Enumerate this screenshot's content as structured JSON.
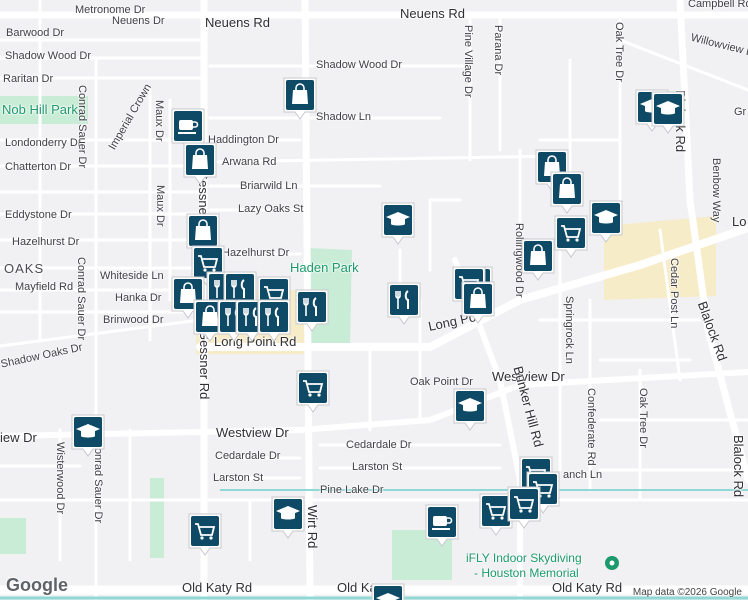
{
  "map": {
    "colors": {
      "background": "#f1f0f3",
      "road": "#ffffff",
      "road_edge": "#d7d6dc",
      "park": "#c9ecd6",
      "commercial": "#f7ecc8",
      "transit": "#8ed8d6",
      "marker": "#0e4a66",
      "park_label": "#1c9a6c"
    },
    "streets": {
      "neuens_rd_top": "Neuens Rd",
      "neuens_dr": "Neuens Dr",
      "metronome_dr": "Metronome Dr",
      "barwood_dr": "Barwood Dr",
      "shadow_wood_dr_w": "Shadow Wood Dr",
      "raritan_dr": "Raritan Dr",
      "nob_hill_park": "Nob Hill Park",
      "londonderry_dr": "Londonderry Dr",
      "chatterton_dr": "Chatterton Dr",
      "eddystone_dr": "Eddystone Dr",
      "hazelhurst_dr_w": "Hazelhurst Dr",
      "oaks": "OAKS",
      "mayfield_rd": "Mayfield Rd",
      "whiteside_ln": "Whiteside Ln",
      "hanka_dr": "Hanka Dr",
      "brinwood_dr": "Brinwood Dr",
      "shadow_oaks_dr": "Shadow Oaks Dr",
      "conrad_sauer_top": "Conrad Sauer Dr",
      "maux_dr_top": "Maux Dr",
      "imperial_crown": "Imperial Crown",
      "maux_dr_mid": "Maux Dr",
      "conrad_sauer_mid": "Conrad Sauer Dr",
      "haddington_dr": "Haddington Dr",
      "arwana_rd": "Arwana Rd",
      "briarwild_ln": "Briarwild Ln",
      "lazy_oaks_st": "Lazy Oaks St",
      "hazelhurst_dr_e": "Hazelhurst Dr",
      "haden_park": "Haden Park",
      "long_point_rd_w": "Long Point Rd",
      "gessner_rd_top": "Gessner Rd",
      "gessner_rd_bot": "Gessner Rd",
      "shadow_wood_dr_c": "Shadow Wood Dr",
      "shadow_ln": "Shadow Ln",
      "pine_village_dr": "Pine Village Dr",
      "parana_dr": "Parana Dr",
      "neuens_rd_right": "Neuens Rd",
      "campbell_rd": "Campbell Rd",
      "willowview_ln": "Willowview Ln",
      "oak_tree_dr_top": "Oak Tree Dr",
      "blalock_rd_top": "Blalock Rd",
      "benbow_way": "Benbow Way",
      "long_point_e": "Long Point Rd",
      "cedar_post_ln": "Cedar Post Ln",
      "blalock_rd_mid": "Blalock Rd",
      "blalock_rd_bot": "Blalock Rd",
      "rollingwood_dr": "Rollingwood Dr",
      "springrock_ln": "Springrock Ln",
      "confederate_rd": "Confederate Rd",
      "oak_tree_dr_bot": "Oak Tree Dr",
      "oak_point_dr": "Oak Point Dr",
      "westview_dr_e": "Westview Dr",
      "bunker_hill_rd": "Bunker Hill Rd",
      "westview_dr_w": "Westview Dr",
      "westview_dr_far": "iew Dr",
      "cedardale_dr_e": "Cedardale Dr",
      "cedardale_dr_w": "Cedardale Dr",
      "larston_st_e": "Larston St",
      "larston_st_w": "Larston St",
      "pine_lake_dr": "Pine Lake Dr",
      "branch_ln": "anch Ln",
      "wisterwood_dr": "Wisterwood Dr",
      "conrad_sauer_bot": "Conrad Sauer Dr",
      "wirt_rd": "Wirt Rd",
      "old_katy_rd_w": "Old Katy Rd",
      "old_katy_rd_c": "Old Ka",
      "old_katy_rd_e": "Old Katy Rd",
      "gr": "Gr",
      "lo": "Lo",
      "long_po_mid": "Long Po",
      "rolling_d": "D"
    },
    "poi": {
      "ifly_line1": "iFLY Indoor Skydiving",
      "ifly_line2": "- Houston Memorial"
    },
    "attribution": "Map data ©2026 Google",
    "logo": "Google"
  },
  "markers": [
    {
      "icon": "shopping-bag-icon"
    },
    {
      "icon": "coffee-cup-icon"
    },
    {
      "icon": "shopping-bag-icon"
    },
    {
      "icon": "shopping-bag-icon"
    },
    {
      "icon": "shopping-cart-icon"
    },
    {
      "icon": "shopping-bag-icon"
    },
    {
      "icon": "restaurant-icon"
    },
    {
      "icon": "restaurant-icon"
    },
    {
      "icon": "shopping-cart-icon"
    },
    {
      "icon": "shopping-bag-icon"
    },
    {
      "icon": "restaurant-icon"
    },
    {
      "icon": "restaurant-icon"
    },
    {
      "icon": "restaurant-icon"
    },
    {
      "icon": "school-icon"
    },
    {
      "icon": "restaurant-icon"
    },
    {
      "icon": "restaurant-icon"
    },
    {
      "icon": "shopping-bag-icon"
    },
    {
      "icon": "shopping-bag-icon"
    },
    {
      "icon": "shopping-bag-icon"
    },
    {
      "icon": "shopping-cart-icon"
    },
    {
      "icon": "school-icon"
    },
    {
      "icon": "shopping-bag-icon"
    },
    {
      "icon": "school-icon"
    },
    {
      "icon": "school-icon"
    },
    {
      "icon": "shopping-cart-icon"
    },
    {
      "icon": "school-icon"
    },
    {
      "icon": "school-icon"
    },
    {
      "icon": "shopping-cart-icon"
    },
    {
      "icon": "shopping-cart-icon"
    },
    {
      "icon": "shopping-cart-icon"
    },
    {
      "icon": "shopping-cart-icon"
    },
    {
      "icon": "coffee-cup-icon"
    },
    {
      "icon": "school-icon"
    },
    {
      "icon": "shopping-cart-icon"
    },
    {
      "icon": "shopping-cart-icon"
    },
    {
      "icon": "shopping-bag-icon"
    },
    {
      "icon": "school-icon"
    }
  ]
}
